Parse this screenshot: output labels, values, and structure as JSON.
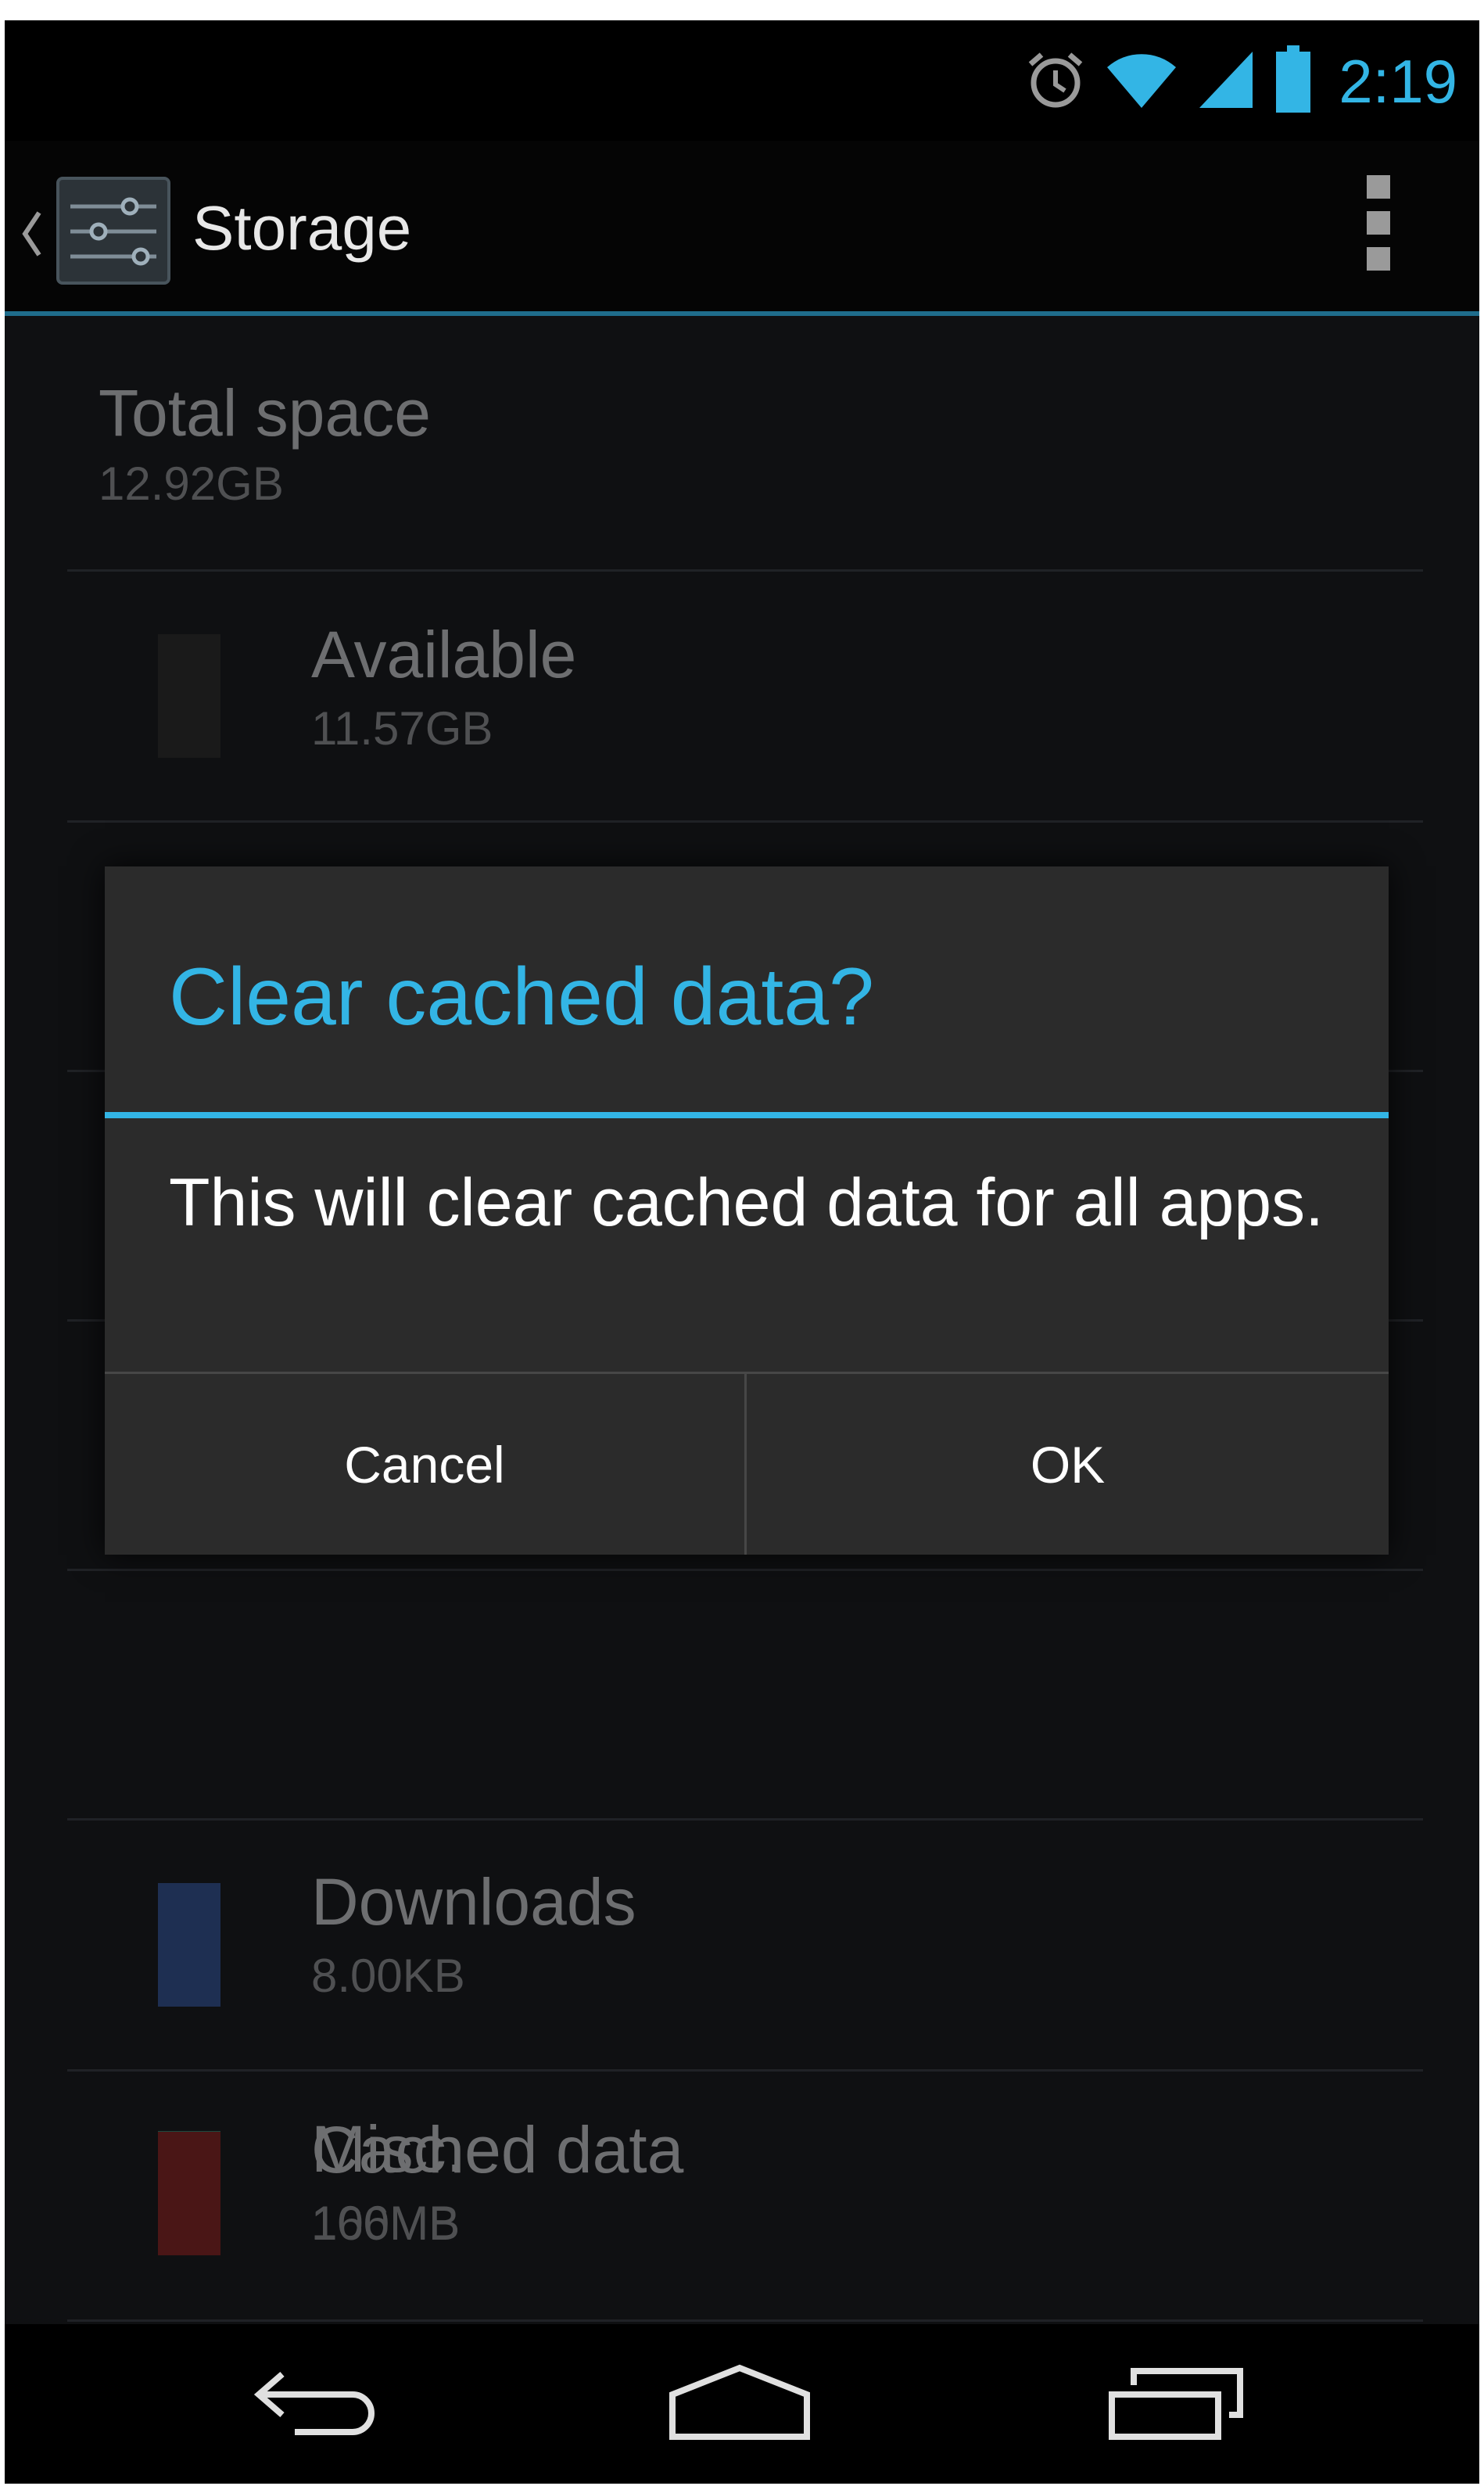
{
  "status_bar": {
    "time": "2:19",
    "icons": [
      "alarm-icon",
      "wifi-icon",
      "cell-signal-icon",
      "battery-icon"
    ]
  },
  "action_bar": {
    "title": "Storage",
    "app_icon": "settings-sliders-icon",
    "overflow_icon": "overflow-menu-icon"
  },
  "storage": {
    "total": {
      "label": "Total space",
      "value": "12.92GB"
    },
    "items": [
      {
        "label": "Available",
        "value": "11.57GB",
        "color": "#1a1a1a"
      },
      {
        "label": "Downloads",
        "value": "8.00KB",
        "color": "#1e2f52"
      },
      {
        "label": "Cached data",
        "value": "160MB",
        "color": "#1d4a3f"
      },
      {
        "label": "Misc.",
        "value": "106MB",
        "color": "#4a1616"
      }
    ]
  },
  "dialog": {
    "title": "Clear cached data?",
    "message": "This will clear cached data for all apps.",
    "cancel_label": "Cancel",
    "ok_label": "OK"
  },
  "nav_bar": {
    "icons": [
      "back-icon",
      "home-icon",
      "recents-icon"
    ]
  },
  "colors": {
    "accent": "#33b5e5",
    "dialog_bg": "#2b2b2b",
    "screen_bg": "#0f1012"
  }
}
